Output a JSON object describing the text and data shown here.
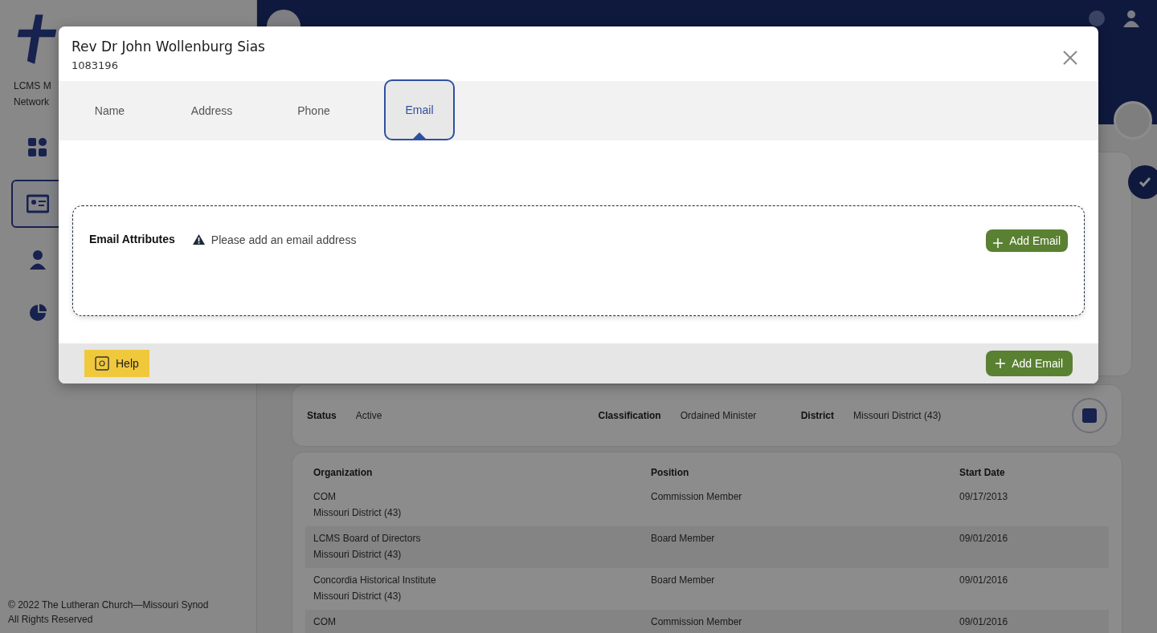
{
  "sidebar": {
    "brand_lines": [
      "LCMS M",
      "Network"
    ],
    "nav_items": [
      {
        "selected": false
      },
      {
        "selected": true
      },
      {
        "selected": false
      },
      {
        "selected": false
      }
    ],
    "footer": [
      "© 2022 The Lutheran Church—Missouri Synod",
      "All Rights Reserved"
    ]
  },
  "summary": [
    {
      "label": "Status",
      "value": "Active"
    },
    {
      "label": "Classification",
      "value": "Ordained Minister"
    },
    {
      "label": "District",
      "value": "Missouri District (43)"
    }
  ],
  "table": {
    "columns": [
      "Organization",
      "Position",
      "Start Date"
    ],
    "rows": [
      {
        "organization": "COM",
        "district": "Missouri District (43)",
        "position": "Commission Member",
        "start_date": "09/17/2013"
      },
      {
        "organization": "LCMS Board of Directors",
        "district": "Missouri District (43)",
        "position": "Board Member",
        "start_date": "09/01/2016"
      },
      {
        "organization": "Concordia Historical Institute",
        "district": "Missouri District (43)",
        "position": "Board Member",
        "start_date": "09/01/2016"
      },
      {
        "organization": "COM",
        "position": "Commission Member",
        "start_date": "09/01/2016"
      }
    ]
  },
  "dialog": {
    "title": "Rev Dr John Wollenburg Sias",
    "subtitle": "1083196",
    "tabs": [
      {
        "label": "Name",
        "selected": false
      },
      {
        "label": "Address",
        "selected": false
      },
      {
        "label": "Phone",
        "selected": false
      },
      {
        "label": "Email",
        "selected": true
      }
    ],
    "section": {
      "title": "Email Attributes",
      "warning": "Please add an email address",
      "add_button": "Add Email"
    },
    "footer": {
      "help": "Help",
      "add_button": "Add Email"
    }
  }
}
